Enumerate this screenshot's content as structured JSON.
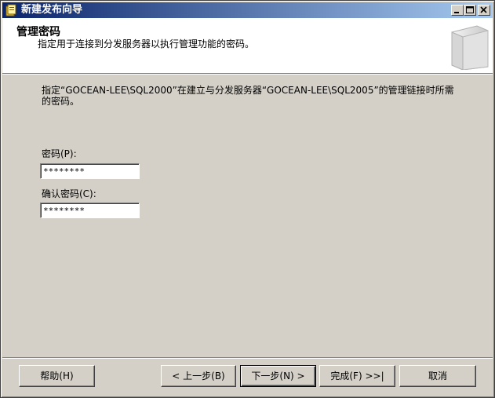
{
  "window": {
    "title": "新建发布向导",
    "controls": {
      "minimize": "minimize-icon",
      "maximize": "maximize-icon",
      "close": "close-icon"
    }
  },
  "header": {
    "title": "管理密码",
    "subtitle": "指定用于连接到分发服务器以执行管理功能的密码。"
  },
  "body": {
    "description": "指定“GOCEAN-LEE\\SQL2000”在建立与分发服务器“GOCEAN-LEE\\SQL2005”的管理链接时所需的密码。",
    "password_label": "密码(P):",
    "password_value": "********",
    "confirm_label": "确认密码(C):",
    "confirm_value": "********"
  },
  "buttons": {
    "help": "帮助(H)",
    "back": "< 上一步(B)",
    "next": "下一步(N) >",
    "finish": "完成(F) >>|",
    "cancel": "取消"
  }
}
